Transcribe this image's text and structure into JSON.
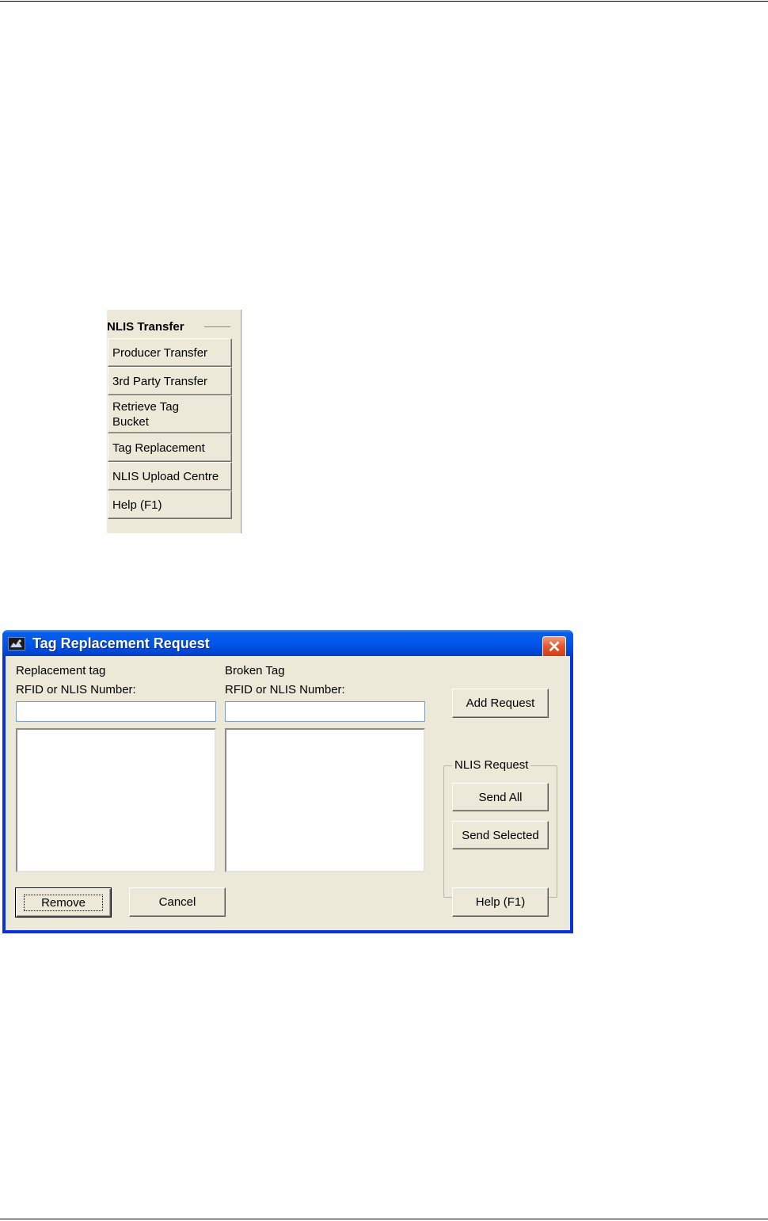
{
  "nlis_panel": {
    "title": "NLIS Transfer",
    "buttons": [
      "Producer Transfer",
      "3rd Party Transfer",
      "Retrieve Tag Bucket",
      "Tag Replacement",
      "NLIS Upload Centre",
      "Help (F1)"
    ]
  },
  "dialog": {
    "title": "Tag Replacement Request",
    "close_glyph": "✕",
    "replacement": {
      "heading": "Replacement tag",
      "field_label": "RFID or NLIS Number:",
      "value": ""
    },
    "broken": {
      "heading": "Broken Tag",
      "field_label": "RFID or NLIS Number:",
      "value": ""
    },
    "add_request_label": "Add Request",
    "nlis_request": {
      "title": "NLIS Request",
      "send_all_label": "Send All",
      "send_selected_label": "Send Selected"
    },
    "remove_label": "Remove",
    "cancel_label": "Cancel",
    "help_label": "Help (F1)"
  },
  "icons": {
    "app_icon": "app-logo-icon",
    "close_icon": "close-icon"
  },
  "colors": {
    "titlebar": "#0058ee",
    "dialog_face": "#ece9d8",
    "close_button": "#e4572f"
  }
}
